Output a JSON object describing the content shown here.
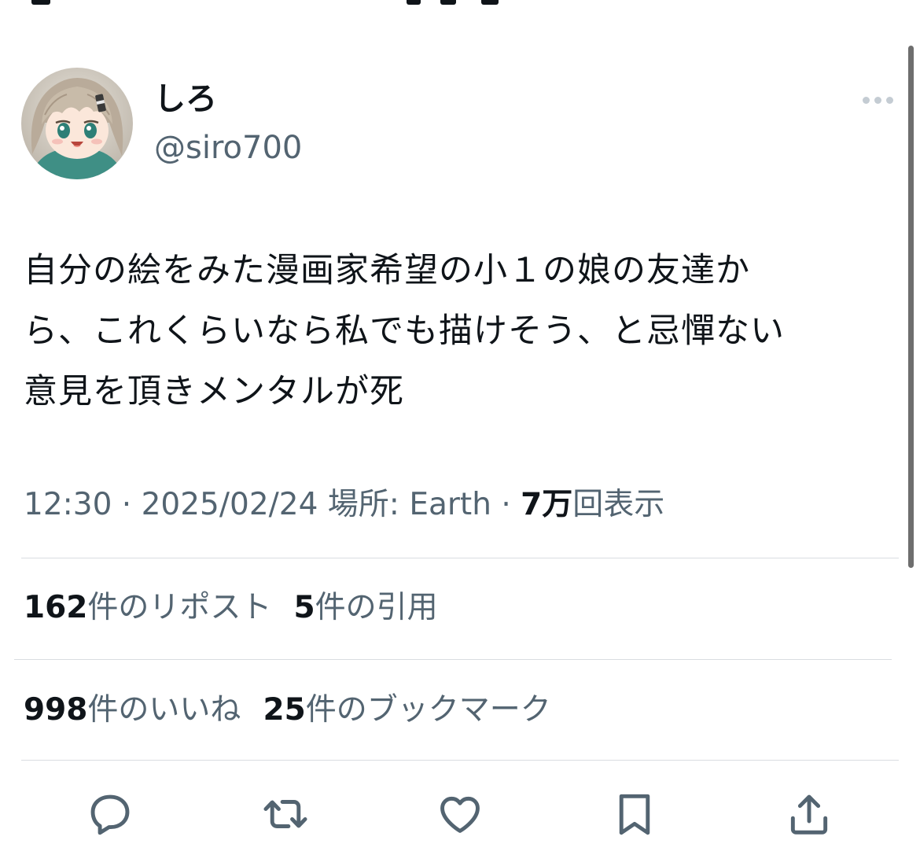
{
  "user": {
    "display_name": "しろ",
    "handle": "@siro700"
  },
  "tweet": {
    "lines": [
      "自分の絵をみた漫画家希望の小１の娘の友達か",
      "ら、これくらいなら私でも描けそう、と忌憚ない",
      "意見を頂きメンタルが死"
    ]
  },
  "meta": {
    "time": "12:30",
    "sep1": " · ",
    "date": "2025/02/24",
    "location_label": " 場所: ",
    "location": "Earth",
    "sep2": " · ",
    "views_num": "7万",
    "views_label": "回表示"
  },
  "stats": {
    "reposts": {
      "num": "162",
      "label": "件のリポスト"
    },
    "quotes": {
      "num": "5",
      "label": "件の引用"
    },
    "likes": {
      "num": "998",
      "label": "件のいいね"
    },
    "bookmarks": {
      "num": "25",
      "label": "件のブックマーク"
    }
  },
  "icons": {
    "more": "more-icon",
    "reply": "reply-icon",
    "retweet": "retweet-icon",
    "like": "heart-icon",
    "bookmark": "bookmark-icon",
    "share": "share-icon"
  },
  "colors": {
    "text": "#0f1419",
    "secondary": "#536471",
    "divider": "#d9dde1",
    "icon": "#536471"
  }
}
